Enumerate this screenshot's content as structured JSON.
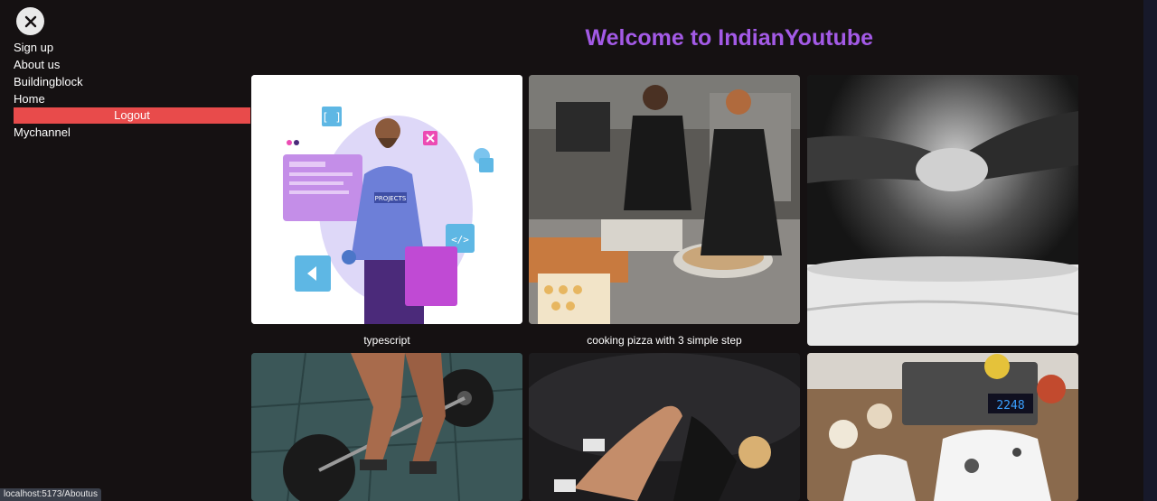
{
  "sidebar": {
    "close_icon": "close-icon",
    "items": [
      {
        "label": "Sign up"
      },
      {
        "label": "About us"
      },
      {
        "label": "Buildingblock"
      },
      {
        "label": "Home"
      },
      {
        "label": "Logout"
      },
      {
        "label": "Mychannel"
      }
    ]
  },
  "main": {
    "title": "Welcome to IndianYoutube",
    "videos": [
      {
        "label": "typescript"
      },
      {
        "label": "cooking pizza with 3 simple step"
      },
      {
        "label": ""
      },
      {
        "label": ""
      },
      {
        "label": ""
      },
      {
        "label": ""
      }
    ]
  },
  "status": {
    "url": "localhost:5173/Aboutus"
  },
  "colors": {
    "title": "#a35ae6",
    "logout": "#e84b4b",
    "background": "#151112"
  }
}
